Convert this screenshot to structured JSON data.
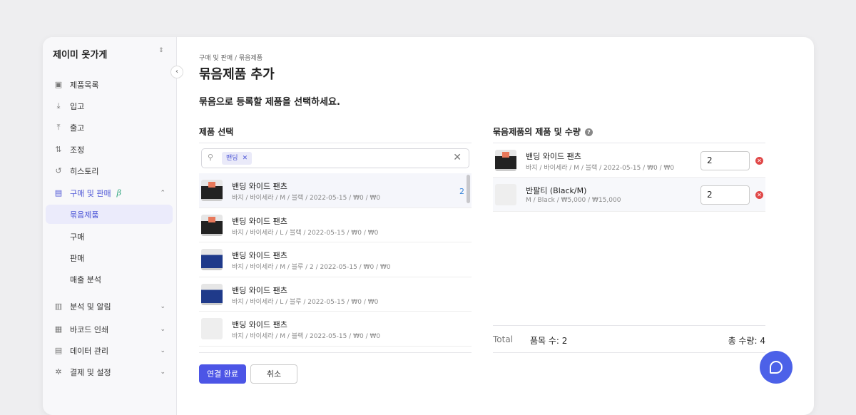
{
  "sidebar": {
    "store": "제이미 옷가게",
    "items": [
      {
        "icon": "box-icon",
        "glyph": "▣",
        "label": "제품목록"
      },
      {
        "icon": "download-icon",
        "glyph": "⤓",
        "label": "입고"
      },
      {
        "icon": "upload-icon",
        "glyph": "⤒",
        "label": "출고"
      },
      {
        "icon": "swap-icon",
        "glyph": "⇅",
        "label": "조정"
      },
      {
        "icon": "history-icon",
        "glyph": "↺",
        "label": "히스토리"
      },
      {
        "icon": "receipt-icon",
        "glyph": "▤",
        "label": "구매 및 판매",
        "badge": "β"
      },
      {
        "label": "묶음제품"
      },
      {
        "label": "구매"
      },
      {
        "label": "판매"
      },
      {
        "label": "매출 분석"
      },
      {
        "icon": "chart-icon",
        "glyph": "▥",
        "label": "분석 및 알림"
      },
      {
        "icon": "barcode-icon",
        "glyph": "▦",
        "label": "바코드 인쇄"
      },
      {
        "icon": "database-icon",
        "glyph": "▤",
        "label": "데이터 관리"
      },
      {
        "icon": "settings-icon",
        "glyph": "✲",
        "label": "결제 및 설정"
      }
    ]
  },
  "main": {
    "breadcrumb": "구매 및 판매 / 묶음제품",
    "title": "묶음제품 추가",
    "subtitle": "묶음으로 등록할 제품을 선택하세요.",
    "left_title": "제품 선택",
    "search_chip": "밴딩",
    "products": [
      {
        "name": "밴딩 와이드 팬츠",
        "meta": "바지 / 바이세라 / M / 블랙 / 2022-05-15 / ₩0 / ₩0",
        "thumb": "black",
        "count": "2"
      },
      {
        "name": "밴딩 와이드 팬츠",
        "meta": "바지 / 바이세라 / L / 블랙 / 2022-05-15 / ₩0 / ₩0",
        "thumb": "black"
      },
      {
        "name": "밴딩 와이드 팬츠",
        "meta": "바지 / 바이세라 / M / 블루 / 2 / 2022-05-15 / ₩0 / ₩0",
        "thumb": "blue"
      },
      {
        "name": "밴딩 와이드 팬츠",
        "meta": "바지 / 바이세라 / L / 블루 / 2022-05-15 / ₩0 / ₩0",
        "thumb": "blue"
      },
      {
        "name": "밴딩 와이드 팬츠",
        "meta": "바지 / 바이세라 / M / 블랙 / 2022-05-15 / ₩0 / ₩0",
        "thumb": "none"
      }
    ],
    "right_title": "묶음제품의 제품 및 수량",
    "bundle": [
      {
        "name": "밴딩 와이드 팬츠",
        "meta": "바지 / 바이세라 / M / 블랙 / 2022-05-15 / ₩0 / ₩0",
        "qty": "2",
        "thumb": "black"
      },
      {
        "name": "반팔티 (Black/M)",
        "meta": "M / Black / ₩5,000 / ₩15,000",
        "qty": "2",
        "thumb": "none"
      }
    ],
    "total_label": "Total",
    "items_count": "품목 수:  2",
    "total_qty": "총 수량:  4",
    "confirm": "연결 완료",
    "cancel": "취소"
  },
  "colors": {
    "accent": "#4c55e6",
    "delete": "#e04848"
  }
}
